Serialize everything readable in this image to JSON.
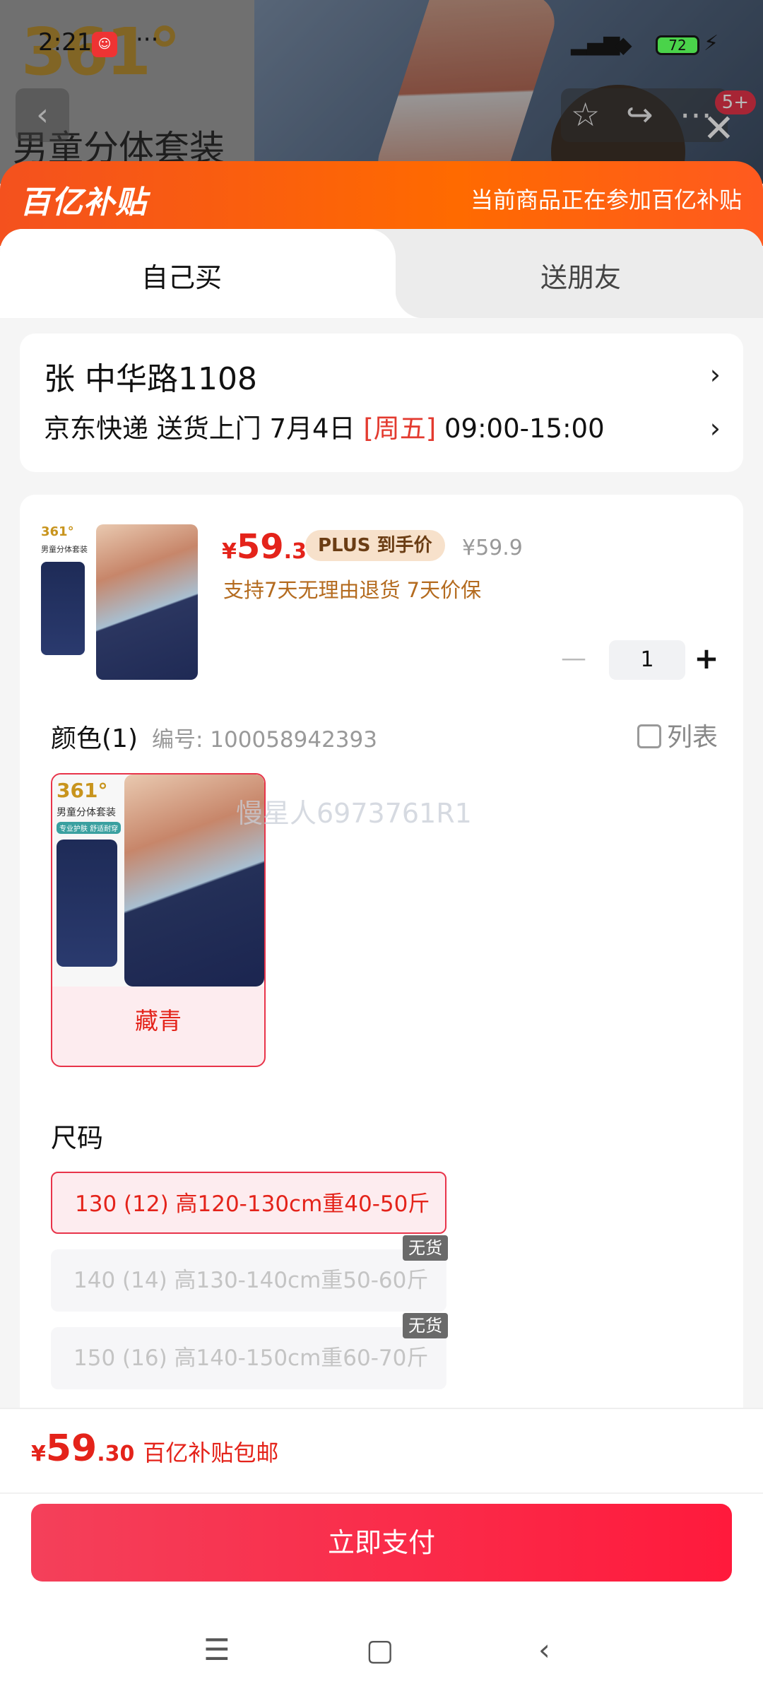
{
  "status_bar": {
    "time": "2:21",
    "more": "···",
    "battery": "72"
  },
  "background_page": {
    "brand_logo": "361°",
    "title": "男童分体套装",
    "badge": "5+"
  },
  "banner": {
    "brand": "百亿补贴",
    "note": "当前商品正在参加百亿补贴"
  },
  "tabs": [
    {
      "label": "自己买"
    },
    {
      "label": "送朋友"
    }
  ],
  "address": {
    "name_line": "张   中华路1108",
    "delivery_prefix": "京东快递 送货上门 7月4日 ",
    "delivery_day": "[周五]",
    "delivery_time": " 09:00-15:00"
  },
  "product": {
    "thumb_logo": "361°",
    "thumb_text": "男童分体套装",
    "price_currency": "¥",
    "price_int": "59",
    "price_dec": ".3",
    "plus_tag": "PLUS 到手价",
    "price_old": "¥59.9",
    "policy": "支持7天无理由退货  7天价保",
    "quantity": "1"
  },
  "color": {
    "heading": "颜色(1)",
    "code": "编号: 100058942393",
    "list_label": "列表",
    "option_logo": "361°",
    "option_img_text": "男童分体套装",
    "option_img_tag": "专业护肤 舒适耐穿",
    "option_label": "藏青"
  },
  "watermark": "慢星人6973761R1",
  "size": {
    "heading": "尺码",
    "options": [
      {
        "label": "130 (12) 高120-130cm重40-50斤",
        "state": "selected"
      },
      {
        "label": "140 (14) 高130-140cm重50-60斤",
        "state": "out_of_stock",
        "badge": "无货"
      },
      {
        "label": "150 (16) 高140-150cm重60-70斤",
        "state": "out_of_stock",
        "badge": "无货"
      }
    ]
  },
  "footer": {
    "currency": "¥",
    "total_int": "59",
    "total_dec": ".30",
    "total_note": "百亿补贴包邮",
    "pay_label": "立即支付"
  },
  "colors": {
    "accent": "#e4231a",
    "banner": "#ff6a00",
    "pay_button": "#ff1a3c"
  }
}
